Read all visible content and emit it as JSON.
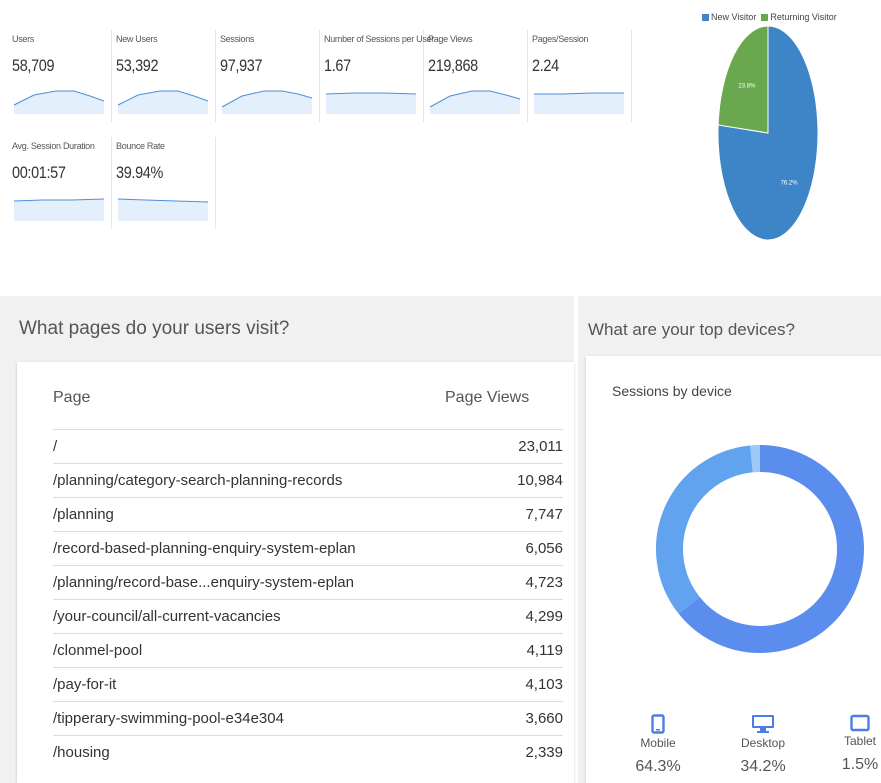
{
  "metrics": [
    {
      "label": "Users",
      "value": "58,709"
    },
    {
      "label": "New Users",
      "value": "53,392"
    },
    {
      "label": "Sessions",
      "value": "97,937"
    },
    {
      "label": "Number of Sessions per User",
      "value": "1.67"
    },
    {
      "label": "Page Views",
      "value": "219,868"
    },
    {
      "label": "Pages/Session",
      "value": "2.24"
    },
    {
      "label": "Avg. Session Duration",
      "value": "00:01:57"
    },
    {
      "label": "Bounce Rate",
      "value": "39.94%"
    }
  ],
  "visitor_chart": {
    "legend": [
      {
        "name": "New Visitor",
        "color": "#3d85c6"
      },
      {
        "name": "Returning Visitor",
        "color": "#6aa84f"
      }
    ],
    "slices": [
      {
        "name": "New Visitor",
        "percent": 76.2,
        "label": "76.2%",
        "color": "#3d85c6"
      },
      {
        "name": "Returning Visitor",
        "percent": 23.8,
        "label": "23.8%",
        "color": "#6aa84f"
      }
    ]
  },
  "pages_panel": {
    "title": "What pages do your users visit?",
    "col_page": "Page",
    "col_views": "Page Views",
    "rows": [
      {
        "page": "/",
        "views": "23,011"
      },
      {
        "page": "/planning/category-search-planning-records",
        "views": "10,984"
      },
      {
        "page": "/planning",
        "views": "7,747"
      },
      {
        "page": "/record-based-planning-enquiry-system-eplan",
        "views": "6,056"
      },
      {
        "page": "/planning/record-base...enquiry-system-eplan",
        "views": "4,723"
      },
      {
        "page": "/your-council/all-current-vacancies",
        "views": "4,299"
      },
      {
        "page": "/clonmel-pool",
        "views": "4,119"
      },
      {
        "page": "/pay-for-it",
        "views": "4,103"
      },
      {
        "page": "/tipperary-swimming-pool-e34e304",
        "views": "3,660"
      },
      {
        "page": "/housing",
        "views": "2,339"
      }
    ]
  },
  "devices_panel": {
    "title": "What are your top devices?",
    "subtitle": "Sessions by device",
    "devices": [
      {
        "name": "Mobile",
        "percent": 64.3,
        "label": "64.3%",
        "icon": "mobile-icon",
        "color": "#5b8def"
      },
      {
        "name": "Desktop",
        "percent": 34.2,
        "label": "34.2%",
        "icon": "desktop-icon",
        "color": "#62a3f0"
      },
      {
        "name": "Tablet",
        "percent": 1.5,
        "label": "1.5%",
        "icon": "tablet-icon",
        "color": "#9cc9f7"
      }
    ]
  }
}
